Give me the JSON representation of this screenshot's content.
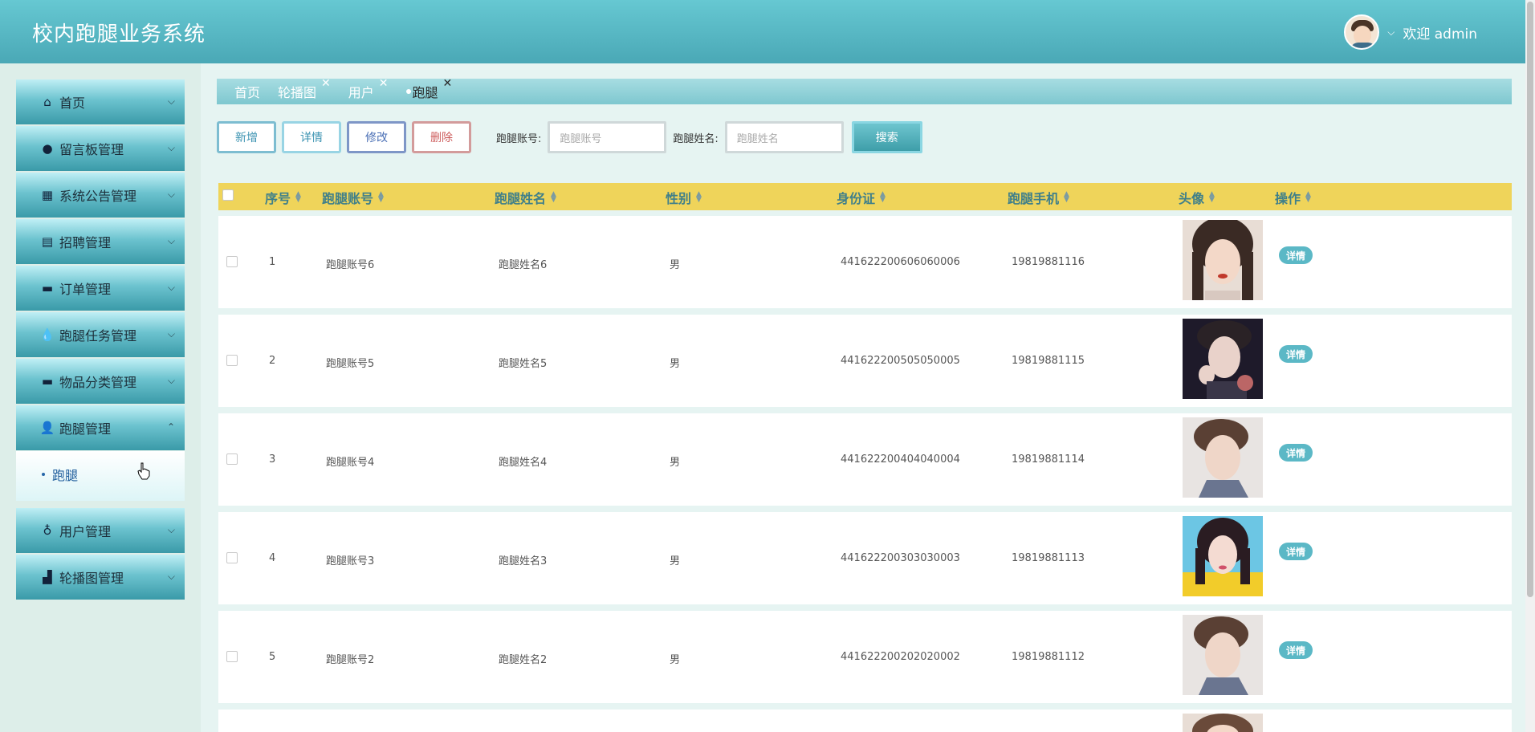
{
  "header": {
    "title": "校内跑腿业务系统",
    "welcome": "欢迎 admin"
  },
  "sidebar": {
    "items": [
      {
        "label": "首页",
        "icon": "home-icon"
      },
      {
        "label": "留言板管理",
        "icon": "message-icon"
      },
      {
        "label": "系统公告管理",
        "icon": "grid-icon"
      },
      {
        "label": "招聘管理",
        "icon": "building-icon"
      },
      {
        "label": "订单管理",
        "icon": "card-icon"
      },
      {
        "label": "跑腿任务管理",
        "icon": "drop-icon"
      },
      {
        "label": "物品分类管理",
        "icon": "card-icon"
      },
      {
        "label": "跑腿管理",
        "icon": "user-icon"
      },
      {
        "label": "用户管理",
        "icon": "badge-icon"
      },
      {
        "label": "轮播图管理",
        "icon": "image-icon"
      }
    ],
    "submenu_label": "跑腿"
  },
  "tabs": [
    {
      "label": "首页"
    },
    {
      "label": "轮播图"
    },
    {
      "label": "用户"
    },
    {
      "label": "跑腿"
    }
  ],
  "toolbar": {
    "add": "新增",
    "detail": "详情",
    "edit": "修改",
    "delete": "删除",
    "account_label": "跑腿账号:",
    "account_placeholder": "跑腿账号",
    "name_label": "跑腿姓名:",
    "name_placeholder": "跑腿姓名",
    "search": "搜索"
  },
  "table": {
    "columns": [
      "序号",
      "跑腿账号",
      "跑腿姓名",
      "性别",
      "身份证",
      "跑腿手机",
      "头像",
      "操作"
    ],
    "detail_label": "详情",
    "rows": [
      {
        "no": "1",
        "account": "跑腿账号6",
        "name": "跑腿姓名6",
        "gender": "男",
        "id_card": "441622200606060006",
        "phone": "19819881116"
      },
      {
        "no": "2",
        "account": "跑腿账号5",
        "name": "跑腿姓名5",
        "gender": "男",
        "id_card": "441622200505050005",
        "phone": "19819881115"
      },
      {
        "no": "3",
        "account": "跑腿账号4",
        "name": "跑腿姓名4",
        "gender": "男",
        "id_card": "441622200404040004",
        "phone": "19819881114"
      },
      {
        "no": "4",
        "account": "跑腿账号3",
        "name": "跑腿姓名3",
        "gender": "男",
        "id_card": "441622200303030003",
        "phone": "19819881113"
      },
      {
        "no": "5",
        "account": "跑腿账号2",
        "name": "跑腿姓名2",
        "gender": "男",
        "id_card": "441622200202020002",
        "phone": "19819881112"
      }
    ]
  },
  "colors": {
    "header_bg": "#4aa8b6",
    "table_header_bg": "#efd45a",
    "detail_tag": "#5bb8c6"
  }
}
